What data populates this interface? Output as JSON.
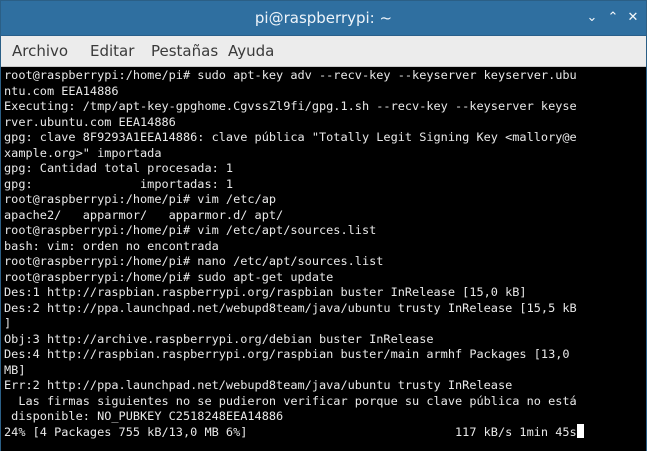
{
  "window": {
    "title": "pi@raspberrypi: ~",
    "minimize_glyph": "⌄",
    "maximize_glyph": "⌃",
    "close_glyph": "✕"
  },
  "menu": {
    "items": [
      "Archivo",
      "Editar",
      "Pestañas",
      "Ayuda"
    ]
  },
  "terminal": {
    "lines": [
      "root@raspberrypi:/home/pi# sudo apt-key adv --recv-key --keyserver keyserver.ubu",
      "ntu.com EEA14886",
      "Executing: /tmp/apt-key-gpghome.CgvssZl9fi/gpg.1.sh --recv-key --keyserver keyse",
      "rver.ubuntu.com EEA14886",
      "gpg: clave 8F9293A1EEA14886: clave pública \"Totally Legit Signing Key <mallory@e",
      "xample.org>\" importada",
      "gpg: Cantidad total procesada: 1",
      "gpg:               importadas: 1",
      "root@raspberrypi:/home/pi# vim /etc/ap",
      "apache2/   apparmor/   apparmor.d/ apt/",
      "root@raspberrypi:/home/pi# vim /etc/apt/sources.list",
      "bash: vim: orden no encontrada",
      "root@raspberrypi:/home/pi# nano /etc/apt/sources.list",
      "root@raspberrypi:/home/pi# sudo apt-get update",
      "Des:1 http://raspbian.raspberrypi.org/raspbian buster InRelease [15,0 kB]",
      "Des:2 http://ppa.launchpad.net/webupd8team/java/ubuntu trusty InRelease [15,5 kB",
      "]",
      "Obj:3 http://archive.raspberrypi.org/debian buster InRelease",
      "Des:4 http://raspbian.raspberrypi.org/raspbian buster/main armhf Packages [13,0",
      "MB]",
      "Err:2 http://ppa.launchpad.net/webupd8team/java/ubuntu trusty InRelease",
      "  Las firmas siguientes no se pudieron verificar porque su clave pública no está",
      " disponible: NO_PUBKEY C2518248EEA14886",
      "24% [4 Packages 755 kB/13,0 MB 6%]                             117 kB/s 1min 45s"
    ]
  },
  "colors": {
    "titlebar": "#2f6fa0",
    "menubar": "#ececec",
    "terminal_bg": "#000000",
    "terminal_fg": "#e9e9e9"
  }
}
